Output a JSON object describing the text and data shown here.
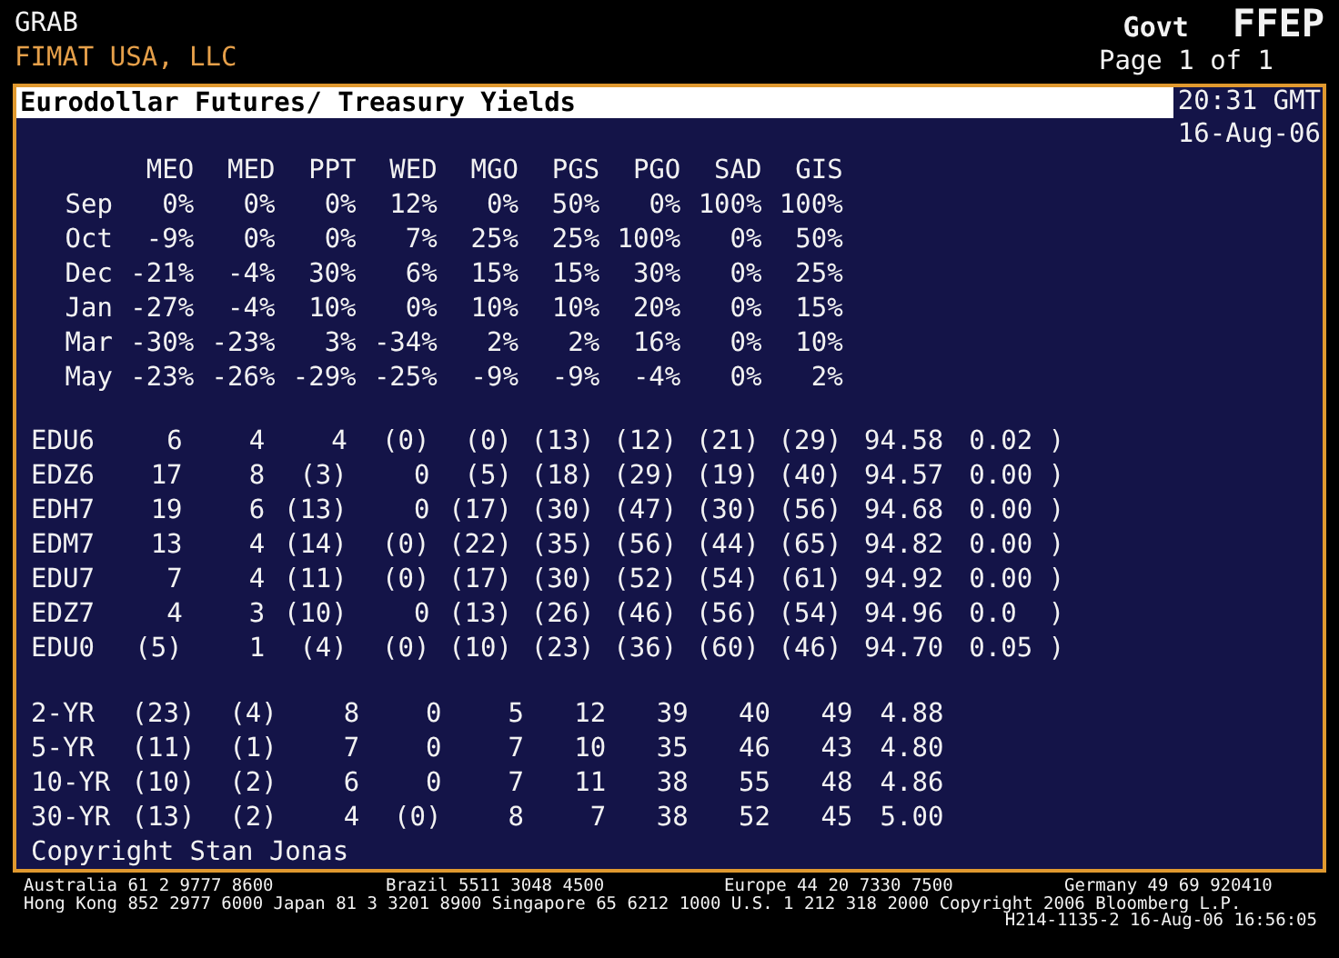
{
  "header": {
    "function": "GRAB",
    "firm": "FIMAT USA, LLC",
    "sector": "Govt",
    "code": "FFEP",
    "page": "Page 1 of 1"
  },
  "title": "Eurodollar Futures/ Treasury Yields",
  "time": "20:31 GMT",
  "date": "16-Aug-06",
  "pct_table": {
    "columns": [
      "MEO",
      "MED",
      "PPT",
      "WED",
      "MGO",
      "PGS",
      "PGO",
      "SAD",
      "GIS"
    ],
    "rows": [
      {
        "label": "Sep",
        "values": [
          "0%",
          "0%",
          "0%",
          "12%",
          "0%",
          "50%",
          "0%",
          "100%",
          "100%"
        ]
      },
      {
        "label": "Oct",
        "values": [
          "-9%",
          "0%",
          "0%",
          "7%",
          "25%",
          "25%",
          "100%",
          "0%",
          "50%"
        ]
      },
      {
        "label": "Dec",
        "values": [
          "-21%",
          "-4%",
          "30%",
          "6%",
          "15%",
          "15%",
          "30%",
          "0%",
          "25%"
        ]
      },
      {
        "label": "Jan",
        "values": [
          "-27%",
          "-4%",
          "10%",
          "0%",
          "10%",
          "10%",
          "20%",
          "0%",
          "15%"
        ]
      },
      {
        "label": "Mar",
        "values": [
          "-30%",
          "-23%",
          "3%",
          "-34%",
          "2%",
          "2%",
          "16%",
          "0%",
          "10%"
        ]
      },
      {
        "label": "May",
        "values": [
          "-23%",
          "-26%",
          "-29%",
          "-25%",
          "-9%",
          "-9%",
          "-4%",
          "0%",
          "2%"
        ]
      }
    ]
  },
  "futures": [
    {
      "label": "EDU6",
      "values": [
        "6",
        "4",
        "4",
        "(0)",
        "(0)",
        "(13)",
        "(12)",
        "(21)",
        "(29)",
        "94.58",
        "0.02 )"
      ]
    },
    {
      "label": "EDZ6",
      "values": [
        "17",
        "8",
        "(3)",
        "0",
        "(5)",
        "(18)",
        "(29)",
        "(19)",
        "(40)",
        "94.57",
        "0.00 )"
      ]
    },
    {
      "label": "EDH7",
      "values": [
        "19",
        "6",
        "(13)",
        "0",
        "(17)",
        "(30)",
        "(47)",
        "(30)",
        "(56)",
        "94.68",
        "0.00 )"
      ]
    },
    {
      "label": "EDM7",
      "values": [
        "13",
        "4",
        "(14)",
        "(0)",
        "(22)",
        "(35)",
        "(56)",
        "(44)",
        "(65)",
        "94.82",
        "0.00 )"
      ]
    },
    {
      "label": "EDU7",
      "values": [
        "7",
        "4",
        "(11)",
        "(0)",
        "(17)",
        "(30)",
        "(52)",
        "(54)",
        "(61)",
        "94.92",
        "0.00 )"
      ]
    },
    {
      "label": "EDZ7",
      "values": [
        "4",
        "3",
        "(10)",
        "0",
        "(13)",
        "(26)",
        "(46)",
        "(56)",
        "(54)",
        "94.96",
        "0.0  )"
      ]
    },
    {
      "label": "EDU0",
      "values": [
        "(5)",
        "1",
        "(4)",
        "(0)",
        "(10)",
        "(23)",
        "(36)",
        "(60)",
        "(46)",
        "94.70",
        "0.05 )"
      ]
    }
  ],
  "treasuries": [
    {
      "label": "2-YR",
      "values": [
        "(23)",
        "(4)",
        "8",
        "0",
        "5",
        "12",
        "39",
        "40",
        "49",
        "4.88"
      ]
    },
    {
      "label": "5-YR",
      "values": [
        "(11)",
        "(1)",
        "7",
        "0",
        "7",
        "10",
        "35",
        "46",
        "43",
        "4.80"
      ]
    },
    {
      "label": "10-YR",
      "values": [
        "(10)",
        "(2)",
        "6",
        "0",
        "7",
        "11",
        "38",
        "55",
        "48",
        "4.86"
      ]
    },
    {
      "label": "30-YR",
      "values": [
        "(13)",
        "(2)",
        "4",
        "(0)",
        "8",
        "7",
        "38",
        "52",
        "45",
        "5.00"
      ]
    }
  ],
  "copyright": "Copyright Stan Jonas",
  "footer": {
    "offices": [
      "Australia 61 2 9777 8600",
      "Brazil 5511 3048 4500",
      "Europe 44 20 7330 7500",
      "Germany 49 69 920410"
    ],
    "line_2": "Hong Kong 852 2977 6000 Japan 81 3 3201 8900 Singapore 65 6212 1000 U.S. 1 212 318 2000 Copyright 2006 Bloomberg L.P.",
    "line_3": "H214-1135-2 16-Aug-06 16:56:05"
  }
}
